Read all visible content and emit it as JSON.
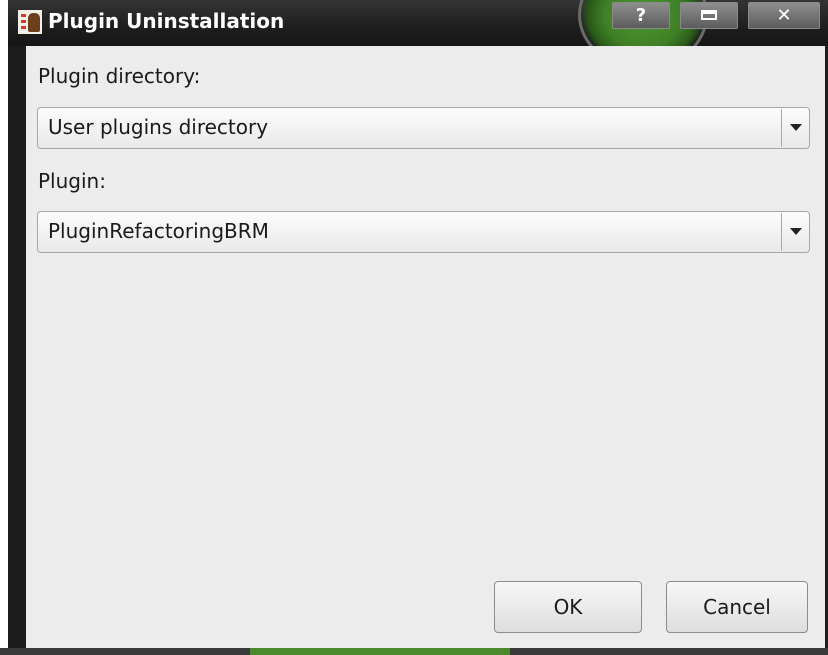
{
  "window": {
    "title": "Plugin Uninstallation",
    "help_label": "?",
    "close_label": "✕",
    "icons": {
      "app": "app-icon",
      "help": "help-icon",
      "maximize": "maximize-icon",
      "close": "close-icon"
    }
  },
  "form": {
    "directory_label": "Plugin directory:",
    "directory_value": "User plugins directory",
    "plugin_label": "Plugin:",
    "plugin_value": "PluginRefactoringBRM"
  },
  "buttons": {
    "ok_label": "OK",
    "cancel_label": "Cancel"
  },
  "colors": {
    "titlebar": "#1e1e1e",
    "dialog_background": "#ececec",
    "accent_green": "#4d9a30"
  }
}
